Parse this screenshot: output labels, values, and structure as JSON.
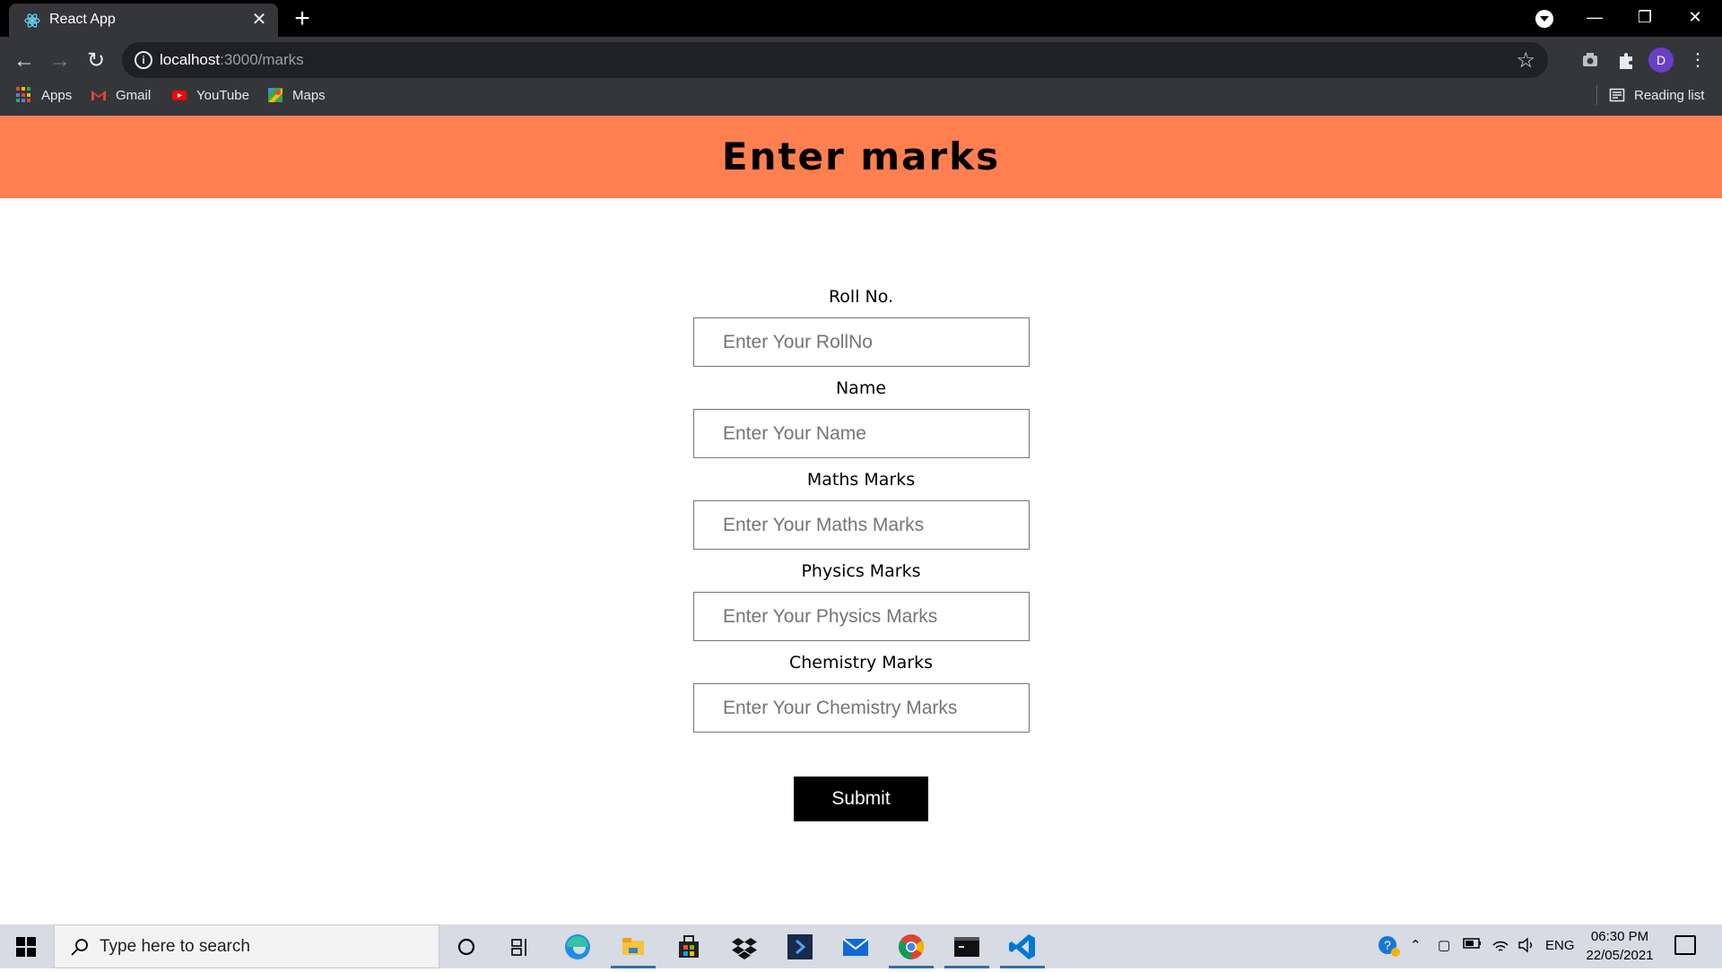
{
  "browser": {
    "tab_title": "React App",
    "tab_close": "✕",
    "new_tab": "+",
    "window_controls": {
      "minimize": "—",
      "restore": "❐",
      "close": "✕"
    },
    "url_host": "localhost",
    "url_path": ":3000/marks",
    "profile_initial": "D",
    "bookmarks": [
      {
        "label": "Apps",
        "icon": "apps-grid-icon"
      },
      {
        "label": "Gmail",
        "icon": "gmail-icon"
      },
      {
        "label": "YouTube",
        "icon": "youtube-icon"
      },
      {
        "label": "Maps",
        "icon": "maps-icon"
      }
    ],
    "reading_list": "Reading list"
  },
  "page": {
    "heading": "Enter marks",
    "fields": [
      {
        "label": "Roll No.",
        "placeholder": "Enter Your RollNo",
        "value": ""
      },
      {
        "label": "Name",
        "placeholder": "Enter Your Name",
        "value": ""
      },
      {
        "label": "Maths Marks",
        "placeholder": "Enter Your Maths Marks",
        "value": ""
      },
      {
        "label": "Physics Marks",
        "placeholder": "Enter Your Physics Marks",
        "value": ""
      },
      {
        "label": "Chemistry Marks",
        "placeholder": "Enter Your Chemistry Marks",
        "value": ""
      }
    ],
    "submit_label": "Submit",
    "header_color": "#ff7f50"
  },
  "taskbar": {
    "search_placeholder": "Type here to search",
    "language": "ENG",
    "time": "06:30 PM",
    "date": "22/05/2021"
  }
}
